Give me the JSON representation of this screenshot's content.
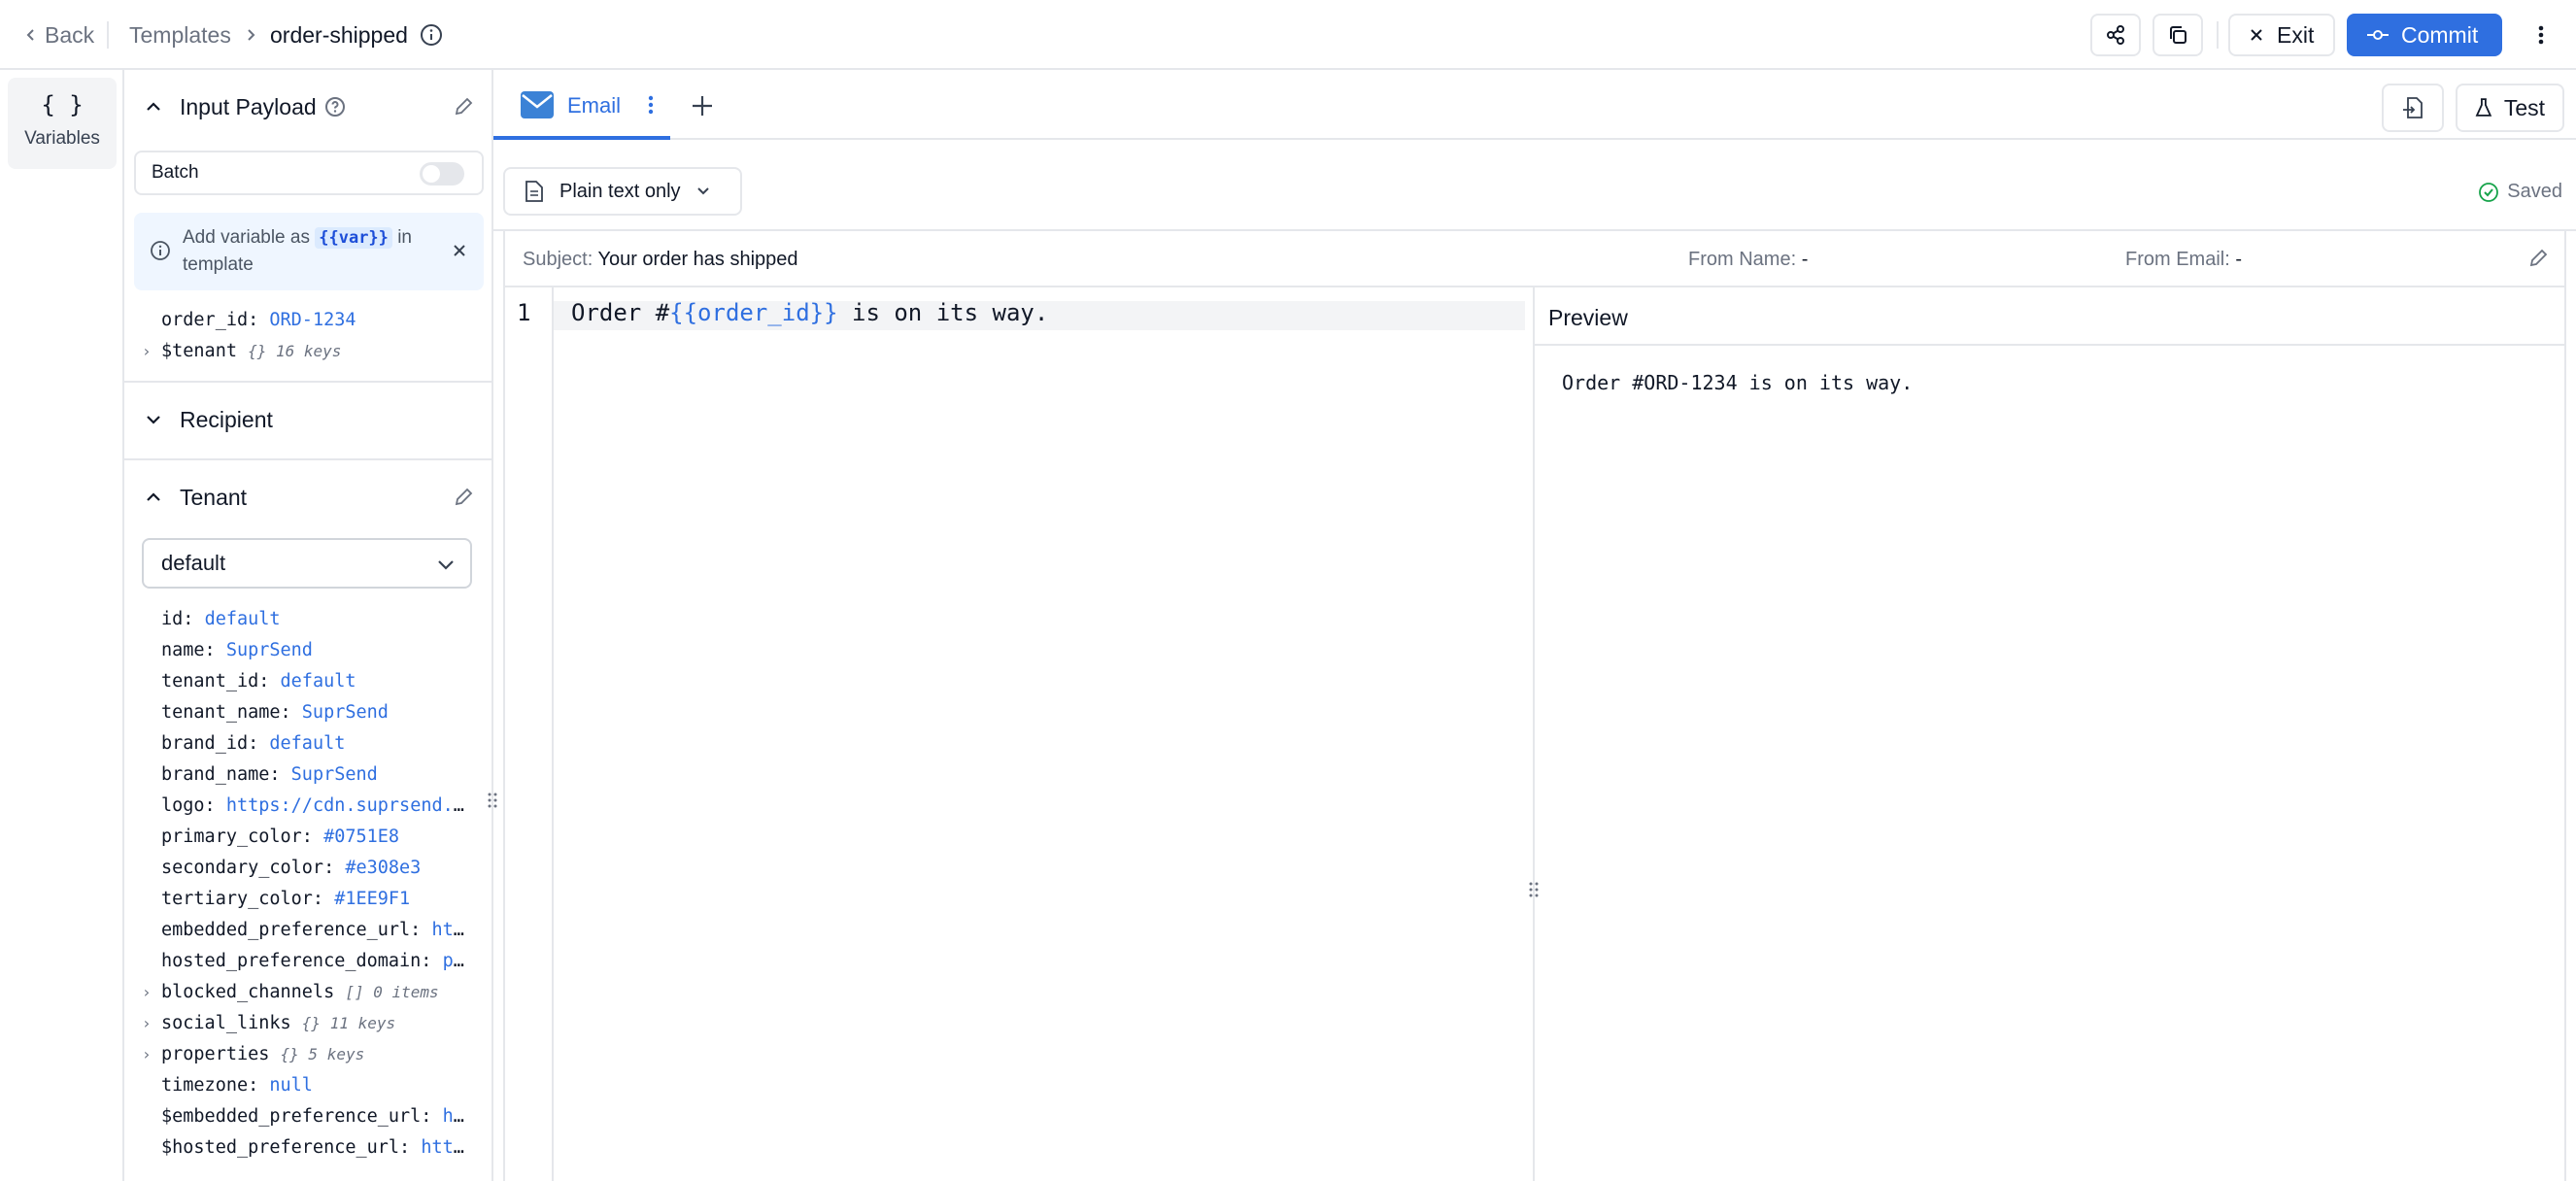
{
  "header": {
    "back_label": "Back",
    "breadcrumb_templates": "Templates",
    "template_name": "order-shipped",
    "exit_label": "Exit",
    "commit_label": "Commit"
  },
  "rail": {
    "variables_glyph": "{ }",
    "variables_label": "Variables"
  },
  "variables_panel": {
    "input_payload": {
      "title": "Input Payload",
      "batch_label": "Batch",
      "batch_enabled": false,
      "hint_prefix": "Add variable as",
      "hint_code": "{{var}}",
      "hint_suffix": "in template",
      "order_id_key": "order_id:",
      "order_id_value": "ORD-1234",
      "tenant_key": "$tenant",
      "tenant_meta": "{} 16 keys"
    },
    "recipient": {
      "title": "Recipient"
    },
    "tenant": {
      "title": "Tenant",
      "selected": "default",
      "fields": [
        {
          "key": "id:",
          "value": "default"
        },
        {
          "key": "name:",
          "value": "SuprSend"
        },
        {
          "key": "tenant_id:",
          "value": "default"
        },
        {
          "key": "tenant_name:",
          "value": "SuprSend"
        },
        {
          "key": "brand_id:",
          "value": "default"
        },
        {
          "key": "brand_name:",
          "value": "SuprSend"
        },
        {
          "key": "logo:",
          "value": "https://cdn.suprsend.io/..."
        },
        {
          "key": "primary_color:",
          "value": "#0751E8"
        },
        {
          "key": "secondary_color:",
          "value": "#e308e3"
        },
        {
          "key": "tertiary_color:",
          "value": "#1EE9F1"
        },
        {
          "key": "embedded_preference_url:",
          "value": "https..."
        },
        {
          "key": "hosted_preference_domain:",
          "value": "pref..."
        }
      ],
      "collapsed": [
        {
          "key": "blocked_channels",
          "meta": "[] 0 items"
        },
        {
          "key": "social_links",
          "meta": "{} 11 keys"
        },
        {
          "key": "properties",
          "meta": "{} 5 keys"
        }
      ],
      "extra_fields": [
        {
          "key": "timezone:",
          "value": "null"
        },
        {
          "key": "$embedded_preference_url:",
          "value": "http..."
        },
        {
          "key": "$hosted_preference_url:",
          "value": "https:..."
        }
      ]
    }
  },
  "editor": {
    "tab_label": "Email",
    "test_label": "Test",
    "mode_label": "Plain text only",
    "saved_label": "Saved",
    "subject_label": "Subject:",
    "subject_value": "Your order has shipped",
    "from_name_label": "From Name:",
    "from_name_value": "-",
    "from_email_label": "From Email:",
    "from_email_value": "-",
    "line_number": "1",
    "code_prefix": "Order #",
    "code_token": "{{order_id}}",
    "code_suffix": " is on its way.",
    "preview_title": "Preview",
    "preview_text": "Order #ORD-1234 is on its way."
  },
  "colors": {
    "accent": "#2f6fe0",
    "border": "#e5e7eb",
    "hint_bg": "#eff6ff",
    "saved_check": "#16a34a"
  }
}
